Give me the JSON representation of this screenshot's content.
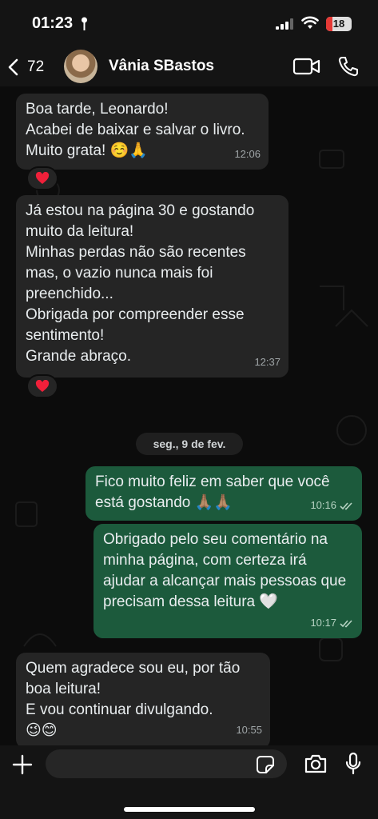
{
  "status_bar": {
    "time": "01:23",
    "battery": "18",
    "battery_color": "#e53935"
  },
  "header": {
    "back_count": "72",
    "contact_name": "Vânia SBastos",
    "icons": [
      "chevron-left-icon",
      "video-call-icon",
      "phone-icon"
    ]
  },
  "messages": [
    {
      "direction": "incoming",
      "text": "Boa tarde, Leonardo!\nAcabei de baixar e salvar o livro.\nMuito grata! ☺️🙏",
      "time": "12:06",
      "reaction": "❤️"
    },
    {
      "direction": "incoming",
      "text": "Já estou na página 30 e gostando muito da leitura!\nMinhas perdas não são recentes mas, o vazio nunca mais foi preenchido...\nObrigada por compreender esse sentimento!\nGrande abraço.",
      "time": "12:37",
      "reaction": "❤️"
    },
    {
      "direction": "outgoing",
      "text": "Fico muito feliz em saber que você está gostando 🙏🏽🙏🏽",
      "time": "10:16",
      "status": "read"
    },
    {
      "direction": "outgoing",
      "text": "Obrigado pelo seu comentário na minha página, com certeza irá ajudar a alcançar mais pessoas que precisam dessa leitura 🤍",
      "time": "10:17",
      "status": "read"
    },
    {
      "direction": "incoming",
      "text": "Quem agradece sou eu, por tão boa leitura!\nE vou continuar divulgando.\n😉😊",
      "time": "10:55"
    }
  ],
  "date_separator": "seg., 9 de fev.",
  "input": {
    "placeholder": "",
    "icons": [
      "plus-icon",
      "sticker-icon",
      "camera-icon",
      "microphone-icon"
    ]
  },
  "colors": {
    "incoming_bubble": "#252525",
    "outgoing_bubble": "#1c5a3c",
    "background": "#0c0c0c"
  }
}
